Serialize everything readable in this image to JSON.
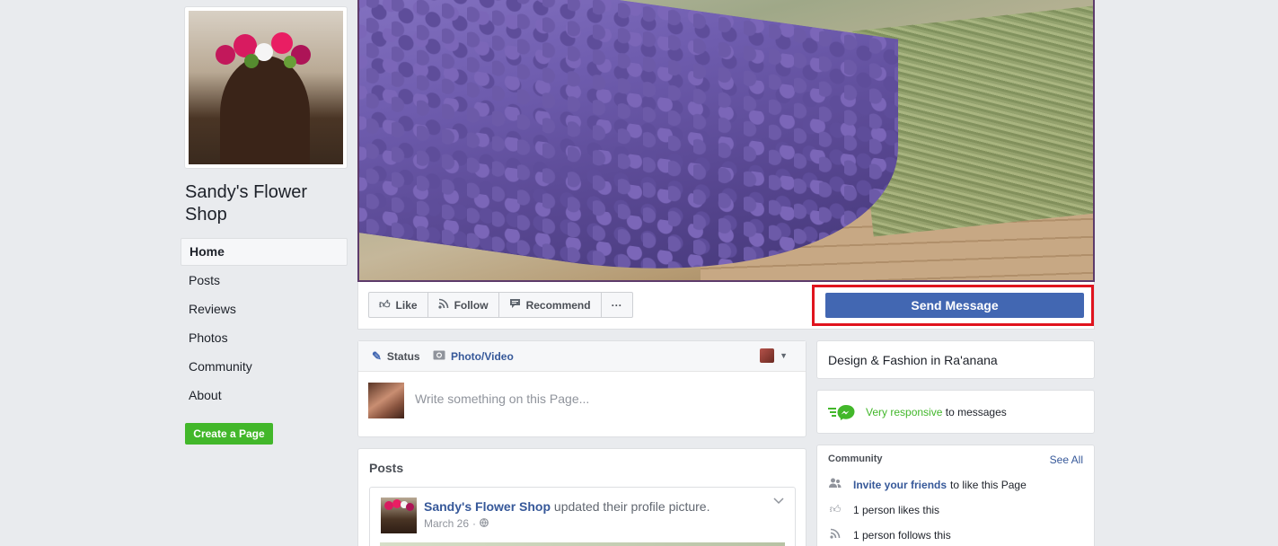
{
  "page": {
    "name": "Sandy's Flower Shop"
  },
  "nav": {
    "items": [
      {
        "label": "Home"
      },
      {
        "label": "Posts"
      },
      {
        "label": "Reviews"
      },
      {
        "label": "Photos"
      },
      {
        "label": "Community"
      },
      {
        "label": "About"
      }
    ],
    "create_page_label": "Create a Page"
  },
  "action_bar": {
    "like_label": "Like",
    "follow_label": "Follow",
    "recommend_label": "Recommend",
    "more_label": "···",
    "send_message_label": "Send Message",
    "highlight_color": "#e0141e"
  },
  "composer": {
    "status_label": "Status",
    "photo_label": "Photo/Video",
    "placeholder": "Write something on this Page..."
  },
  "posts": {
    "title": "Posts",
    "items": [
      {
        "author": "Sandy's Flower Shop",
        "action": "updated their profile picture.",
        "date": "March 26",
        "separator": "·"
      }
    ]
  },
  "sidebar": {
    "category": "Design & Fashion in Ra'anana",
    "responsiveness": {
      "highlight": "Very responsive",
      "rest": "to messages"
    },
    "community": {
      "title": "Community",
      "see_all": "See All",
      "invite_link": "Invite your friends",
      "invite_rest": "to like this Page",
      "likes": "1 person likes this",
      "follows": "1 person follows this"
    }
  },
  "colors": {
    "brand_blue": "#4267b2",
    "link_blue": "#365899",
    "green": "#42b72a",
    "background": "#e9ebee"
  },
  "icons": [
    "thumbs-up-icon",
    "rss-icon",
    "speech-bubble-icon",
    "more-icon",
    "pencil-icon",
    "camera-icon",
    "chevron-down-icon",
    "messenger-icon",
    "friends-icon",
    "globe-icon"
  ]
}
